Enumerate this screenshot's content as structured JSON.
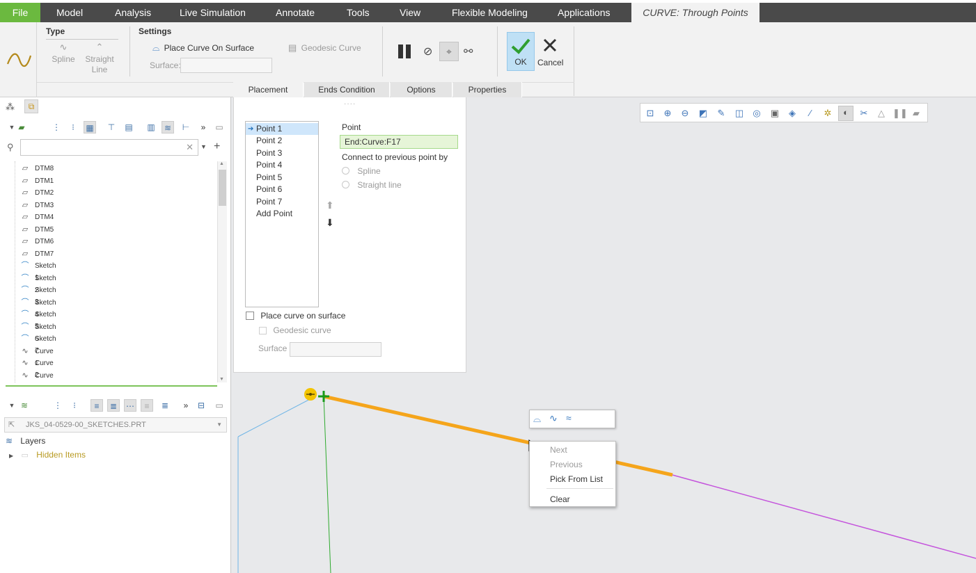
{
  "menu": {
    "file": "File",
    "items": [
      "Model",
      "Analysis",
      "Live Simulation",
      "Annotate",
      "Tools",
      "View",
      "Flexible Modeling",
      "Applications"
    ],
    "context_tab": "CURVE: Through Points"
  },
  "ribbon": {
    "type_label": "Type",
    "spline": "Spline",
    "straight_line": [
      "Straight",
      "Line"
    ],
    "settings_label": "Settings",
    "place_on_surface": "Place Curve On Surface",
    "geodesic": "Geodesic Curve",
    "surface_label": "Surface:",
    "ok": "OK",
    "cancel": "Cancel"
  },
  "dashboard_tabs": [
    "Placement",
    "Ends Condition",
    "Options",
    "Properties"
  ],
  "placement": {
    "points": [
      "Point 1",
      "Point 2",
      "Point 3",
      "Point 4",
      "Point 5",
      "Point 6",
      "Point 7",
      "Add Point"
    ],
    "selected_index": 0,
    "point_label": "Point",
    "point_value": "End:Curve:F17",
    "connect_label": "Connect to previous point by",
    "opt_spline": "Spline",
    "opt_straight": "Straight line",
    "place_on_surface": "Place curve on surface",
    "geodesic": "Geodesic curve",
    "surface_label": "Surface"
  },
  "model_tree": {
    "items": [
      {
        "icon": "datum-plane-icon",
        "label": "DTM8"
      },
      {
        "icon": "datum-plane-icon",
        "label": "DTM1"
      },
      {
        "icon": "datum-plane-icon",
        "label": "DTM2"
      },
      {
        "icon": "datum-plane-icon",
        "label": "DTM3"
      },
      {
        "icon": "datum-plane-icon",
        "label": "DTM4"
      },
      {
        "icon": "datum-plane-icon",
        "label": "DTM5"
      },
      {
        "icon": "datum-plane-icon",
        "label": "DTM6"
      },
      {
        "icon": "datum-plane-icon",
        "label": "DTM7"
      },
      {
        "icon": "sketch-icon",
        "label": "Sketch 1"
      },
      {
        "icon": "sketch-icon",
        "label": "Sketch 2"
      },
      {
        "icon": "sketch-icon",
        "label": "Sketch 3"
      },
      {
        "icon": "sketch-icon",
        "label": "Sketch 4"
      },
      {
        "icon": "sketch-icon",
        "label": "Sketch 5"
      },
      {
        "icon": "sketch-icon",
        "label": "Sketch 6"
      },
      {
        "icon": "sketch-icon",
        "label": "Sketch 7"
      },
      {
        "icon": "curve-icon",
        "label": "Curve 1"
      },
      {
        "icon": "curve-icon",
        "label": "Curve 2"
      },
      {
        "icon": "curve-icon",
        "label": "Curve 3"
      }
    ]
  },
  "layers": {
    "model_name": "JKS_04-0529-00_SKETCHES.PRT",
    "root": "Layers",
    "hidden": "Hidden Items"
  },
  "context_menu": {
    "next": "Next",
    "previous": "Previous",
    "pick_from_list": "Pick From List",
    "clear": "Clear"
  },
  "colors": {
    "file_green": "#6bb93f",
    "ok_blue": "#bfe0f5",
    "selected_curve": "#f5a51b",
    "curve_magenta": "#c454dc",
    "datum_green": "#2eaa2e",
    "sketch_blue": "#6fb5e6",
    "point_field_bg": "#e6f5d8"
  }
}
